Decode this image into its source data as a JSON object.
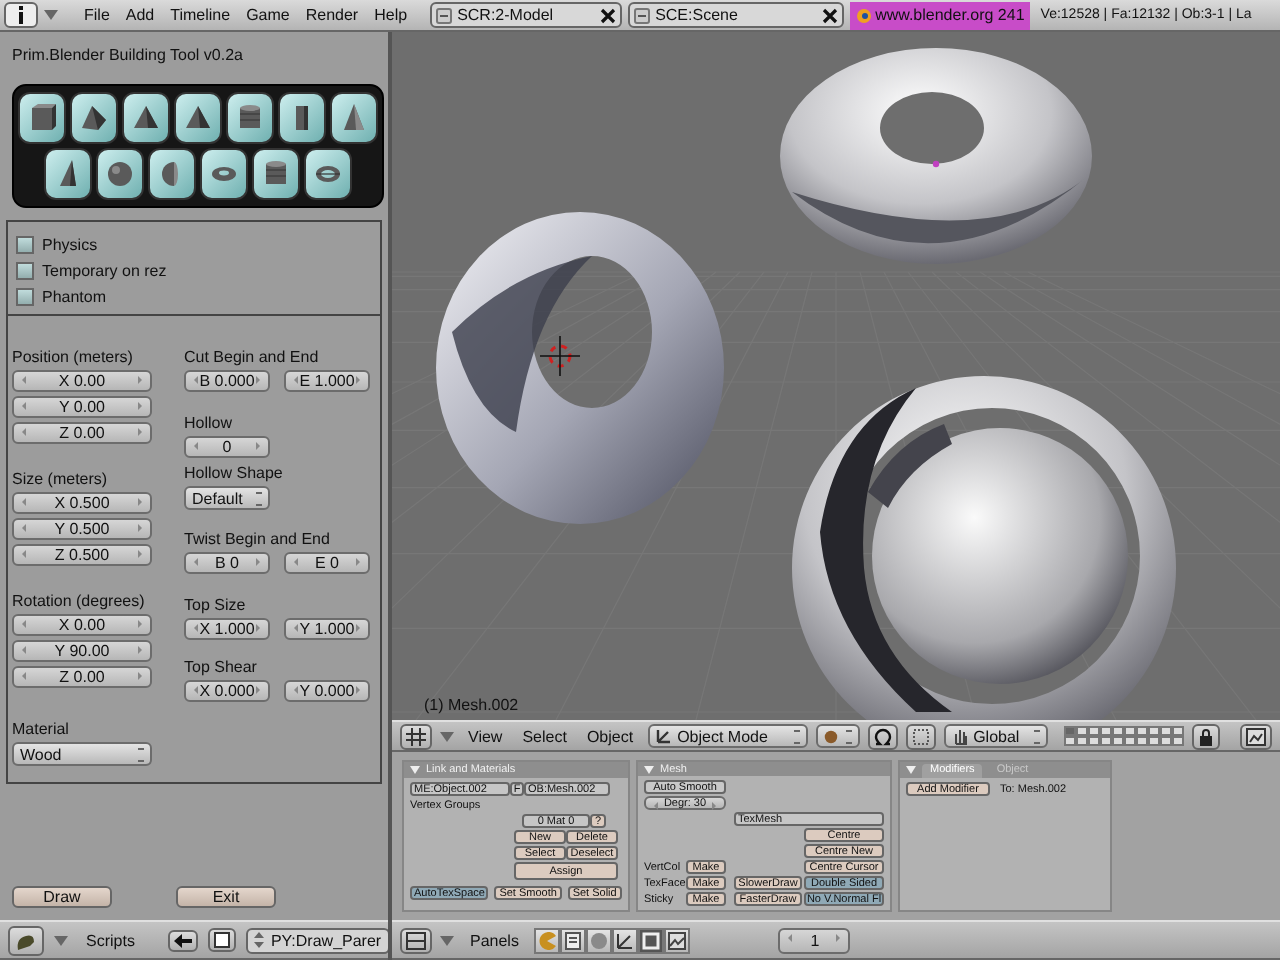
{
  "top_bar": {
    "menus": [
      "File",
      "Add",
      "Timeline",
      "Game",
      "Render",
      "Help"
    ],
    "screen": "SCR:2-Model",
    "scene": "SCE:Scene",
    "link": "www.blender.org 241",
    "stats": "Ve:12528 | Fa:12132 | Ob:3-1 | La"
  },
  "script_panel": {
    "title": "Prim.Blender Building Tool v0.2a",
    "primitive_rows": [
      {
        "buttons": [
          {
            "kind": "box"
          },
          {
            "kind": "prism"
          },
          {
            "kind": "pyramid"
          },
          {
            "kind": "pyramid"
          },
          {
            "kind": "cylinder"
          },
          {
            "kind": "tube"
          },
          {
            "kind": "cone"
          }
        ]
      },
      {
        "buttons": [
          {
            "kind": "wedge"
          },
          {
            "kind": "sphere"
          },
          {
            "kind": "hemisphere"
          },
          {
            "kind": "torus"
          },
          {
            "kind": "cylinder"
          },
          {
            "kind": "ring"
          }
        ]
      }
    ],
    "options": [
      {
        "label": "Physics",
        "checked": false
      },
      {
        "label": "Temporary on rez",
        "checked": false
      },
      {
        "label": "Phantom",
        "checked": false
      }
    ],
    "left_groups": [
      {
        "label": "Position (meters)",
        "kind": "number",
        "fields": [
          "X 0.00",
          "Y 0.00",
          "Z 0.00"
        ]
      },
      {
        "label": "Size (meters)",
        "kind": "number",
        "fields": [
          "X 0.500",
          "Y 0.500",
          "Z 0.500"
        ]
      },
      {
        "label": "Rotation (degrees)",
        "kind": "number",
        "fields": [
          "X 0.00",
          "Y 90.00",
          "Z 0.00"
        ]
      },
      {
        "label": "Material",
        "kind": "menu",
        "fields": [
          "Wood"
        ]
      }
    ],
    "right_groups": [
      {
        "label": "Cut Begin and End",
        "kind": "number",
        "fields": [
          "B 0.000",
          "E 1.000"
        ]
      },
      {
        "label": "Hollow",
        "kind": "number",
        "fields": [
          "0"
        ]
      },
      {
        "label": "Hollow Shape",
        "kind": "menu",
        "fields": [
          "Default"
        ]
      },
      {
        "label": "Twist Begin and End",
        "kind": "number",
        "fields": [
          "B 0",
          "E 0"
        ]
      },
      {
        "label": "Top Size",
        "kind": "number",
        "fields": [
          "X 1.000",
          "Y 1.000"
        ]
      },
      {
        "label": "Top Shear",
        "kind": "number",
        "fields": [
          "X 0.000",
          "Y 0.000"
        ]
      }
    ],
    "buttons": [
      "Draw",
      "Exit"
    ]
  },
  "script_header": {
    "menu": "Scripts",
    "script": "PY:Draw_Parer"
  },
  "viewport": {
    "label": "(1) Mesh.002"
  },
  "view_header": {
    "menus": [
      "View",
      "Select",
      "Object"
    ],
    "mode": "Object Mode",
    "orientation": "Global",
    "layers": [
      {
        "on": true
      },
      {
        "on": false
      },
      {
        "on": false
      },
      {
        "on": false
      },
      {
        "on": false
      },
      {
        "on": false
      },
      {
        "on": false
      },
      {
        "on": false
      },
      {
        "on": false
      },
      {
        "on": false
      },
      {
        "on": false
      },
      {
        "on": false
      },
      {
        "on": false
      },
      {
        "on": false
      },
      {
        "on": false
      },
      {
        "on": false
      },
      {
        "on": false
      },
      {
        "on": false
      },
      {
        "on": false
      },
      {
        "on": false
      }
    ]
  },
  "buttons_window": {
    "link_panel": {
      "title": "Link and Materials",
      "mesh_name": "ME:Object.002",
      "fake_user": "F",
      "object_name": "OB:Mesh.002",
      "vertex_groups_label": "Vertex Groups",
      "material": "0 Mat 0",
      "material_help": "?",
      "pair_buttons": [
        "New",
        "Delete",
        "Select",
        "Deselect"
      ],
      "assign": "Assign",
      "bottom_buttons": [
        "AutoTexSpace",
        "Set Smooth",
        "Set Solid"
      ]
    },
    "mesh_panel": {
      "title": "Mesh",
      "auto_smooth": "Auto Smooth",
      "degr": "Degr: 30",
      "tex_mesh": "TexMesh",
      "centre_buttons": [
        "Centre",
        "Centre New",
        "Centre Cursor"
      ],
      "make_rows": [
        {
          "label": "VertCol",
          "button": "Make"
        },
        {
          "label": "TexFace",
          "button": "Make"
        },
        {
          "label": "Sticky",
          "button": "Make"
        }
      ],
      "draw_buttons": [
        "SlowerDraw",
        "FasterDraw"
      ],
      "toggles": [
        {
          "label": "Double Sided",
          "on": true
        },
        {
          "label": "No V.Normal Fl",
          "on": true
        }
      ]
    },
    "modifiers_panel": {
      "tabs": [
        {
          "label": "Modifiers",
          "selected": true
        },
        {
          "label": "Object",
          "selected": false
        }
      ],
      "add_button": "Add Modifier",
      "target": "To: Mesh.002"
    }
  },
  "buttons_header": {
    "label": "Panels",
    "contexts": [
      {
        "kind": "logic",
        "selected": false
      },
      {
        "kind": "script",
        "selected": false
      },
      {
        "kind": "shading",
        "selected": false
      },
      {
        "kind": "object",
        "selected": false
      },
      {
        "kind": "editing",
        "selected": true
      },
      {
        "kind": "scene",
        "selected": false
      }
    ],
    "frame": "1"
  }
}
